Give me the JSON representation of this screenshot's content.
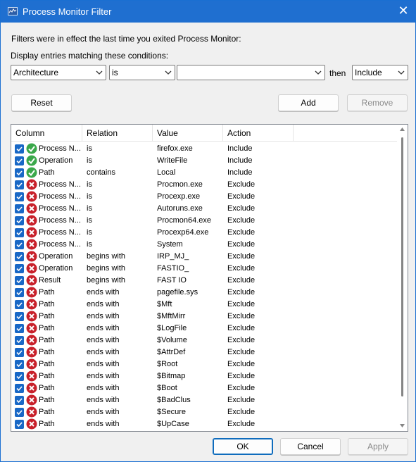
{
  "window": {
    "title": "Process Monitor Filter",
    "close_glyph": "✕"
  },
  "intro_text": "Filters were in effect the last time you exited Process Monitor:",
  "conditions_label": "Display entries matching these conditions:",
  "condition": {
    "column_value": "Architecture",
    "relation_value": "is",
    "value_value": "",
    "then_label": "then",
    "action_value": "Include"
  },
  "buttons": {
    "reset": "Reset",
    "add": "Add",
    "remove": "Remove",
    "ok": "OK",
    "cancel": "Cancel",
    "apply": "Apply"
  },
  "table": {
    "columns": [
      "Column",
      "Relation",
      "Value",
      "Action"
    ],
    "rows": [
      {
        "column": "Process N...",
        "relation": "is",
        "value": "firefox.exe",
        "action": "Include",
        "checked": true
      },
      {
        "column": "Operation",
        "relation": "is",
        "value": "WriteFile",
        "action": "Include",
        "checked": true
      },
      {
        "column": "Path",
        "relation": "contains",
        "value": "Local",
        "action": "Include",
        "checked": true
      },
      {
        "column": "Process N...",
        "relation": "is",
        "value": "Procmon.exe",
        "action": "Exclude",
        "checked": true
      },
      {
        "column": "Process N...",
        "relation": "is",
        "value": "Procexp.exe",
        "action": "Exclude",
        "checked": true
      },
      {
        "column": "Process N...",
        "relation": "is",
        "value": "Autoruns.exe",
        "action": "Exclude",
        "checked": true
      },
      {
        "column": "Process N...",
        "relation": "is",
        "value": "Procmon64.exe",
        "action": "Exclude",
        "checked": true
      },
      {
        "column": "Process N...",
        "relation": "is",
        "value": "Procexp64.exe",
        "action": "Exclude",
        "checked": true
      },
      {
        "column": "Process N...",
        "relation": "is",
        "value": "System",
        "action": "Exclude",
        "checked": true
      },
      {
        "column": "Operation",
        "relation": "begins with",
        "value": "IRP_MJ_",
        "action": "Exclude",
        "checked": true
      },
      {
        "column": "Operation",
        "relation": "begins with",
        "value": "FASTIO_",
        "action": "Exclude",
        "checked": true
      },
      {
        "column": "Result",
        "relation": "begins with",
        "value": "FAST IO",
        "action": "Exclude",
        "checked": true
      },
      {
        "column": "Path",
        "relation": "ends with",
        "value": "pagefile.sys",
        "action": "Exclude",
        "checked": true
      },
      {
        "column": "Path",
        "relation": "ends with",
        "value": "$Mft",
        "action": "Exclude",
        "checked": true
      },
      {
        "column": "Path",
        "relation": "ends with",
        "value": "$MftMirr",
        "action": "Exclude",
        "checked": true
      },
      {
        "column": "Path",
        "relation": "ends with",
        "value": "$LogFile",
        "action": "Exclude",
        "checked": true
      },
      {
        "column": "Path",
        "relation": "ends with",
        "value": "$Volume",
        "action": "Exclude",
        "checked": true
      },
      {
        "column": "Path",
        "relation": "ends with",
        "value": "$AttrDef",
        "action": "Exclude",
        "checked": true
      },
      {
        "column": "Path",
        "relation": "ends with",
        "value": "$Root",
        "action": "Exclude",
        "checked": true
      },
      {
        "column": "Path",
        "relation": "ends with",
        "value": "$Bitmap",
        "action": "Exclude",
        "checked": true
      },
      {
        "column": "Path",
        "relation": "ends with",
        "value": "$Boot",
        "action": "Exclude",
        "checked": true
      },
      {
        "column": "Path",
        "relation": "ends with",
        "value": "$BadClus",
        "action": "Exclude",
        "checked": true
      },
      {
        "column": "Path",
        "relation": "ends with",
        "value": "$Secure",
        "action": "Exclude",
        "checked": true
      },
      {
        "column": "Path",
        "relation": "ends with",
        "value": "$UpCase",
        "action": "Exclude",
        "checked": true
      }
    ]
  },
  "colors": {
    "titlebar": "#1f6fd0",
    "checkbox": "#1968c6",
    "include_icon": "#3aa84a",
    "exclude_icon": "#c8202a"
  },
  "icons": {
    "title": "process-monitor-icon",
    "include": "green-check-icon",
    "exclude": "red-x-icon"
  }
}
